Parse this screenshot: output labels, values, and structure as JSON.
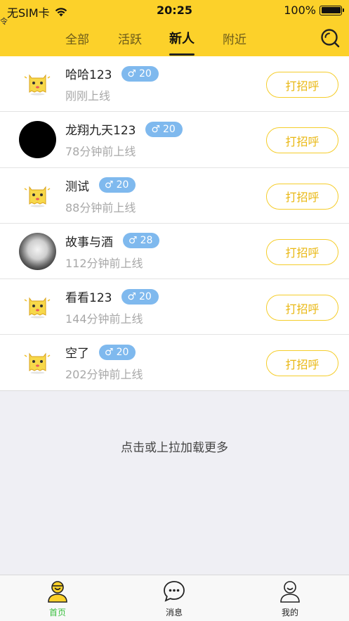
{
  "status_bar": {
    "carrier": "无SIM卡",
    "time": "20:25",
    "battery": "100%",
    "corner_glyph": "令"
  },
  "tabs": [
    {
      "label": "全部",
      "active": false
    },
    {
      "label": "活跃",
      "active": false
    },
    {
      "label": "新人",
      "active": true
    },
    {
      "label": "附近",
      "active": false
    }
  ],
  "users": [
    {
      "name": "哈哈123",
      "age": "20",
      "gender": "♂",
      "last_online": "刚刚上线",
      "avatar": "default-monster-avatar",
      "greet_label": "打招呼"
    },
    {
      "name": "龙翔九天123",
      "age": "20",
      "gender": "♂",
      "last_online": "78分钟前上线",
      "avatar": "black-avatar",
      "greet_label": "打招呼"
    },
    {
      "name": "测试",
      "age": "20",
      "gender": "♂",
      "last_online": "88分钟前上线",
      "avatar": "default-monster-avatar",
      "greet_label": "打招呼"
    },
    {
      "name": "故事与酒",
      "age": "28",
      "gender": "♂",
      "last_online": "112分钟前上线",
      "avatar": "photo-avatar",
      "greet_label": "打招呼"
    },
    {
      "name": "看看123",
      "age": "20",
      "gender": "♂",
      "last_online": "144分钟前上线",
      "avatar": "default-monster-avatar",
      "greet_label": "打招呼"
    },
    {
      "name": "空了",
      "age": "20",
      "gender": "♂",
      "last_online": "202分钟前上线",
      "avatar": "default-monster-avatar",
      "greet_label": "打招呼"
    }
  ],
  "load_more": "点击或上拉加载更多",
  "tabbar": [
    {
      "label": "首页",
      "icon": "home-face-icon",
      "active": true
    },
    {
      "label": "消息",
      "icon": "message-bubble-icon",
      "active": false
    },
    {
      "label": "我的",
      "icon": "profile-person-icon",
      "active": false
    }
  ],
  "colors": {
    "header": "#fcd12a",
    "badge": "#7fb9ee",
    "greet_border": "#f5cd2b",
    "greet_text": "#e9b814",
    "tab_active": "#3bbf3f"
  }
}
